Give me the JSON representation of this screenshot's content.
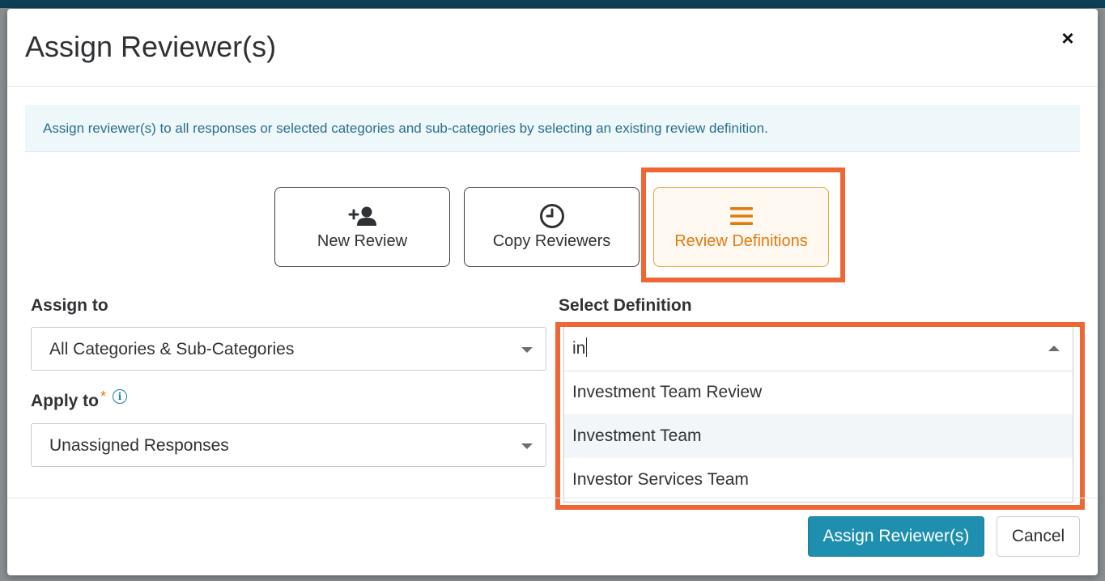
{
  "modal": {
    "title": "Assign Reviewer(s)",
    "close_label": "×",
    "info": "Assign reviewer(s) to all responses or selected categories and sub-categories by selecting an existing review definition."
  },
  "modes": [
    {
      "label": "New Review",
      "icon": "add-user-icon"
    },
    {
      "label": "Copy Reviewers",
      "icon": "clock-icon"
    },
    {
      "label": "Review Definitions",
      "icon": "list-icon",
      "selected": true
    }
  ],
  "assign_to": {
    "label": "Assign to",
    "value": "All Categories & Sub-Categories"
  },
  "apply_to": {
    "label": "Apply to",
    "required_mark": "*",
    "info_icon_glyph": "i",
    "value": "Unassigned Responses"
  },
  "select_definition": {
    "label": "Select Definition",
    "query": "in",
    "options": [
      "Investment Team Review",
      "Investment Team",
      "Investor Services Team"
    ],
    "hovered_index": 1
  },
  "footer": {
    "assign_label": "Assign Reviewer(s)",
    "cancel_label": "Cancel"
  },
  "colors": {
    "accent": "#1f8fb0",
    "selected_orange": "#e07b10",
    "highlight": "#ee6633"
  }
}
